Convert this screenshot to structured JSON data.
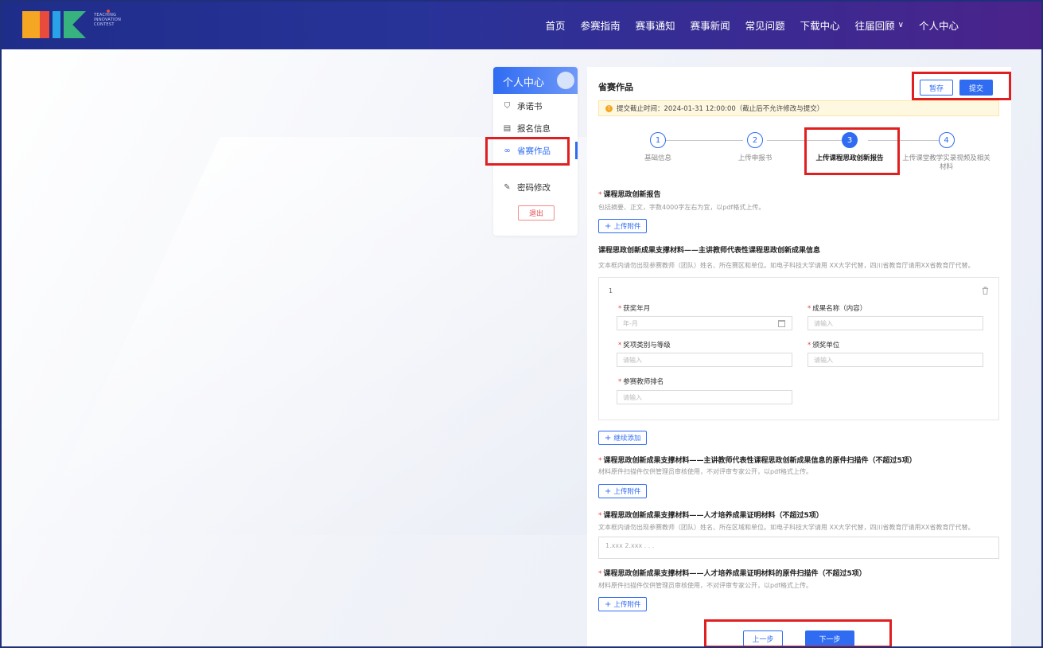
{
  "header": {
    "logo_text": "TEACHING INNOVATION CONTEST",
    "nav": [
      {
        "label": "首页"
      },
      {
        "label": "参赛指南"
      },
      {
        "label": "赛事通知"
      },
      {
        "label": "赛事新闻"
      },
      {
        "label": "常见问题"
      },
      {
        "label": "下载中心"
      },
      {
        "label": "往届回顾",
        "has_dropdown": true
      },
      {
        "label": "个人中心"
      }
    ]
  },
  "sidebar": {
    "title": "个人中心",
    "items": [
      {
        "label": "承诺书",
        "icon": "shield-icon"
      },
      {
        "label": "报名信息",
        "icon": "form-icon"
      },
      {
        "label": "省赛作品",
        "icon": "link-icon",
        "active": true
      },
      {
        "label": "密码修改",
        "icon": "edit-icon"
      }
    ],
    "logout_label": "退出"
  },
  "panel": {
    "title": "省赛作品",
    "save_label": "暂存",
    "submit_label": "提交",
    "notice": "提交截止时间：2024-01-31 12:00:00（截止后不允许修改与提交）",
    "steps": [
      {
        "num": "1",
        "label": "基础信息"
      },
      {
        "num": "2",
        "label": "上传申报书"
      },
      {
        "num": "3",
        "label": "上传课程思政创新报告",
        "current": true
      },
      {
        "num": "4",
        "label": "上传课堂教学实录视频及相关材料"
      }
    ],
    "section1": {
      "title": "课程思政创新报告",
      "desc": "包括摘要、正文，字数4000字左右为宜，以pdf格式上传。",
      "upload_label": "上传附件"
    },
    "section2": {
      "title": "课程思政创新成果支撑材料——主讲教师代表性课程思政创新成果信息",
      "desc": "文本框内请勿出现参赛教师（团队）姓名、所在赛区和单位。如电子科技大学请用 XX大学代替，四川省教育厅请用XX省教育厅代替。",
      "item_index": "1",
      "fields": {
        "award_date_label": "获奖年月",
        "award_date_placeholder": "年-月",
        "achievement_name_label": "成果名称（内容）",
        "achievement_name_placeholder": "请输入",
        "award_type_label": "奖项类别与等级",
        "award_type_placeholder": "请输入",
        "issuer_label": "颁奖单位",
        "issuer_placeholder": "请输入",
        "teacher_rank_label": "参赛教师排名",
        "teacher_rank_placeholder": "请输入"
      },
      "add_more_label": "继续添加"
    },
    "section3": {
      "title": "课程思政创新成果支撑材料——主讲教师代表性课程思政创新成果信息的原件扫描件（不超过5项）",
      "desc": "材料原件扫描件仅供管理员审核使用，不对评审专家公开，以pdf格式上传。",
      "upload_label": "上传附件"
    },
    "section4": {
      "title": "课程思政创新成果支撑材料——人才培养成果证明材料（不超过5项）",
      "desc": "文本框内请勿出现参赛教师（团队）姓名、所在区域和单位。如电子科技大学请用 XX大学代替，四川省教育厅请用XX省教育厅代替。",
      "textarea_placeholder": "1.xxx 2.xxx . . ."
    },
    "section5": {
      "title": "课程思政创新成果支撑材料——人才培养成果证明材料的原件扫描件（不超过5项）",
      "desc": "材料原件扫描件仅供管理员审核使用，不对评审专家公开，以pdf格式上传。",
      "upload_label": "上传附件"
    },
    "prev_label": "上一步",
    "next_label": "下一步"
  },
  "colors": {
    "primary": "#2f6cf2",
    "header_start": "#1f2d8a",
    "header_end": "#4a238a",
    "highlight": "#e02020",
    "required": "#e04848"
  }
}
